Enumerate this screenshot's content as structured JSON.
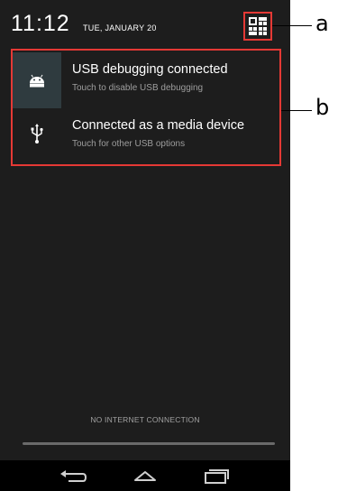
{
  "status": {
    "time": "11:12",
    "date": "TUE, JANUARY 20"
  },
  "notifications": [
    {
      "title": "USB debugging connected",
      "subtitle": "Touch to disable USB debugging",
      "icon": "android-icon"
    },
    {
      "title": "Connected as a media device",
      "subtitle": "Touch for other USB options",
      "icon": "usb-icon"
    }
  ],
  "footer": {
    "network_status": "NO INTERNET CONNECTION"
  },
  "nav": {
    "buttons": [
      "back-icon",
      "home-icon",
      "recents-icon"
    ]
  },
  "annotations": {
    "a": "a",
    "b": "b"
  },
  "colors": {
    "highlight": "#e53935",
    "shade_bg": "#1d1d1d"
  }
}
